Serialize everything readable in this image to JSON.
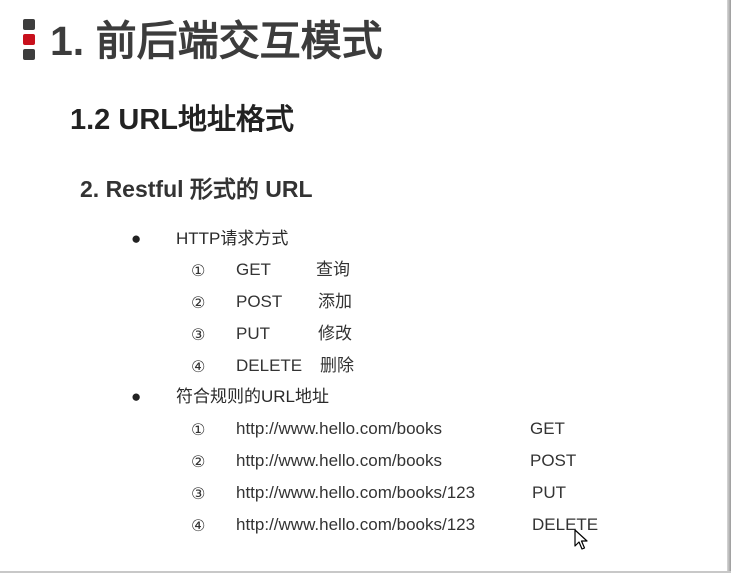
{
  "slide": {
    "main_title": "1. 前后端交互模式",
    "section_title": "1.2 URL地址格式",
    "subsection_title": "2. Restful 形式的 URL",
    "bullet_symbol": "●",
    "groups": [
      {
        "label": "HTTP请求方式",
        "items": [
          {
            "num": "①",
            "col1": "GET",
            "col2": "查询"
          },
          {
            "num": "②",
            "col1": "POST",
            "col2": "添加"
          },
          {
            "num": "③",
            "col1": "PUT",
            "col2": "修改"
          },
          {
            "num": "④",
            "col1": "DELETE",
            "col2": "删除"
          }
        ]
      },
      {
        "label": "符合规则的URL地址",
        "items": [
          {
            "num": "①",
            "col1": "http://www.hello.com/books",
            "col2": "GET"
          },
          {
            "num": "②",
            "col1": "http://www.hello.com/books",
            "col2": "POST"
          },
          {
            "num": "③",
            "col1": "http://www.hello.com/books/123",
            "col2": "PUT"
          },
          {
            "num": "④",
            "col1": "http://www.hello.com/books/123",
            "col2": "DELETE"
          }
        ]
      }
    ]
  },
  "colors": {
    "title_text": "#3c3c3c",
    "marker_dark": "#3d3d3d",
    "marker_accent": "#c8101c"
  }
}
